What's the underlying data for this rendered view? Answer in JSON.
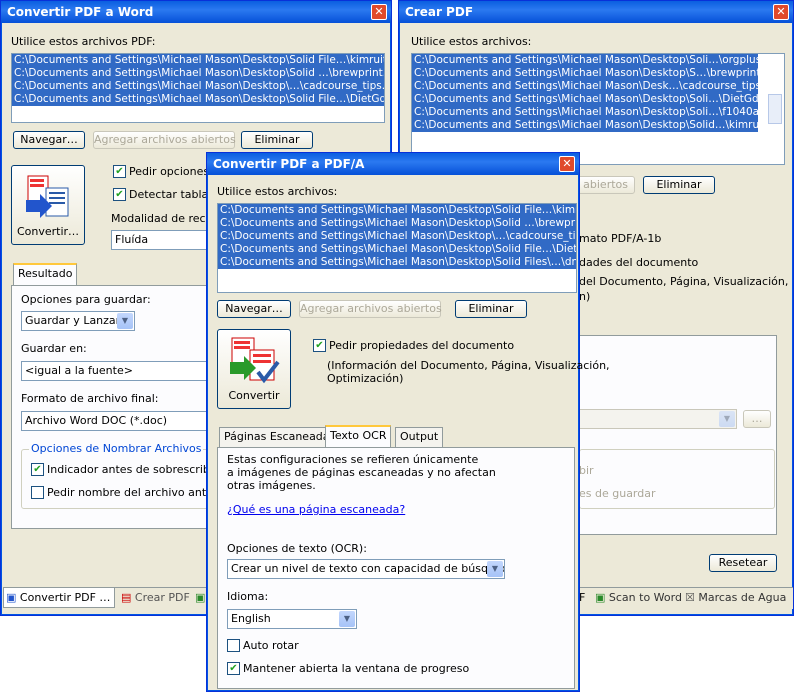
{
  "win1": {
    "title": "Convertir PDF a Word",
    "list_label": "Utilice estos archivos PDF:",
    "files": [
      "C:\\Documents and Settings\\Michael Mason\\Desktop\\Solid File…\\kimruit.pdf",
      "C:\\Documents and Settings\\Michael Mason\\Desktop\\Solid …\\brewprint.pdf",
      "C:\\Documents and Settings\\Michael Mason\\Desktop\\…\\cadcourse_tips.pdf",
      "C:\\Documents and Settings\\Michael Mason\\Desktop\\Solid File…\\DietGd.pdf"
    ],
    "browse": "Navegar…",
    "add_open": "Agregar archivos abiertos",
    "remove": "Eliminar",
    "convert": "Convertir…",
    "opt_props": "Pedir opciones",
    "opt_tables": "Detectar tablas",
    "mode_label": "Modalidad de recons",
    "mode_value": "Fluída",
    "tab_result": "Resultado",
    "save_opts_label": "Opciones para guardar:",
    "save_opts_value": "Guardar y Lanzar",
    "save_in_label": "Guardar en:",
    "save_in_value": "<igual a la fuente>",
    "format_label": "Formato de archivo final:",
    "format_value": "Archivo Word DOC (*.doc)",
    "naming_group": "Opciones de Nombrar Archivos",
    "naming_1": "Indicador antes de sobrescribir",
    "naming_2": "Pedir nombre del archivo antes de",
    "bottom_tabs": [
      "Convertir PDF …",
      "Crear PDF"
    ]
  },
  "win2": {
    "title": "Crear PDF",
    "list_label": "Utilice estos archivos:",
    "files": [
      "C:\\Documents and Settings\\Michael Mason\\Desktop\\Soli…\\orgplus.pdf",
      "C:\\Documents and Settings\\Michael Mason\\Desktop\\S…\\brewprint.pdf",
      "C:\\Documents and Settings\\Michael Mason\\Desk…\\cadcourse_tips.pdf",
      "C:\\Documents and Settings\\Michael Mason\\Desktop\\Soli…\\DietGd.pdf",
      "C:\\Documents and Settings\\Michael Mason\\Desktop\\Soli…\\f1040a.pdf",
      "C:\\Documents and Settings\\Michael Mason\\Desktop\\Solid…\\kimruit.pdf"
    ],
    "add_open_partial": "abiertos",
    "remove": "Eliminar",
    "text1": "mato PDF/A-1b",
    "text2": "dades del documento",
    "text3": "del Documento, Página, Visualización,",
    "text4": "n)",
    "dim1": "bir",
    "dim2": "es de guardar",
    "ellipsis": "…",
    "reset": "Resetear",
    "bottom_tabs": [
      "Scan to Word",
      "Marcas de Agua"
    ],
    "tab_partial": "F"
  },
  "win3": {
    "title": "Convertir PDF a PDF/A",
    "list_label": "Utilice estos archivos:",
    "files": [
      "C:\\Documents and Settings\\Michael Mason\\Desktop\\Solid File…\\kimruit.pdf",
      "C:\\Documents and Settings\\Michael Mason\\Desktop\\Solid …\\brewprint.pdf",
      "C:\\Documents and Settings\\Michael Mason\\Desktop\\…\\cadcourse_tips.pdf",
      "C:\\Documents and Settings\\Michael Mason\\Desktop\\Solid File…\\DietGd.pdf",
      "C:\\Documents and Settings\\Michael Mason\\Desktop\\Solid Files\\…\\dmca.pdf"
    ],
    "browse": "Navegar…",
    "add_open": "Agregar archivos abiertos",
    "remove": "Eliminar",
    "convert": "Convertir",
    "ask_props": "Pedir propiedades del documento",
    "props_desc_1": "(Información del Documento, Página, Visualización,",
    "props_desc_2": "Optimización)",
    "tabs": [
      "Páginas Escaneadas",
      "Texto OCR",
      "Output"
    ],
    "desc_1": "Estas configuraciones se refieren únicamente",
    "desc_2": "a imágenes de páginas escaneadas y no afectan",
    "desc_3": "otras imágenes.",
    "link": "¿Qué es una página escaneada?",
    "ocr_label": "Opciones de texto (OCR):",
    "ocr_value": "Crear un nivel de texto con capacidad de búsqueda",
    "lang_label": "Idioma:",
    "lang_value": "English",
    "auto_rotate": "Auto rotar",
    "keep_progress": "Mantener abierta la ventana de progreso"
  }
}
